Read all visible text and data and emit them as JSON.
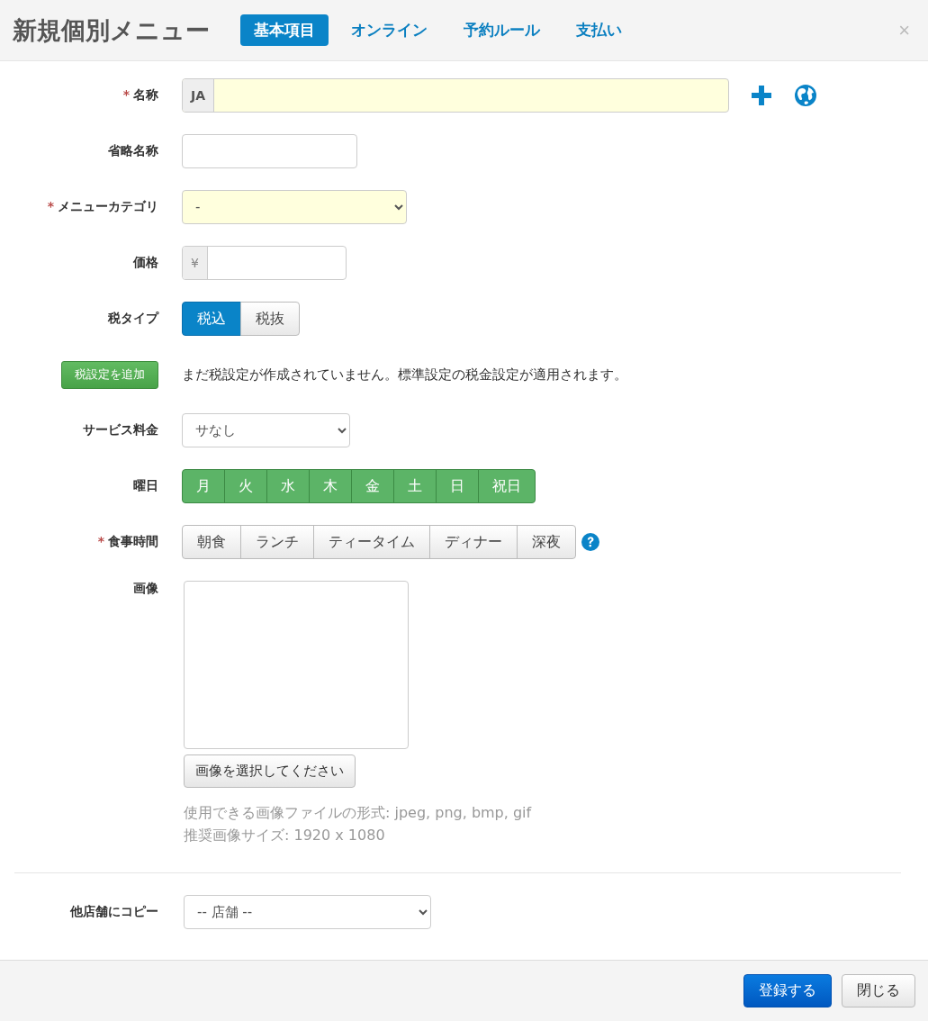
{
  "dialog": {
    "title": "新規個別メニュー",
    "close": "×"
  },
  "tabs": [
    {
      "label": "基本項目",
      "selected": true
    },
    {
      "label": "オンライン",
      "selected": false
    },
    {
      "label": "予約ルール",
      "selected": false
    },
    {
      "label": "支払い",
      "selected": false
    }
  ],
  "fields": [
    {
      "kind": "lang_text",
      "mark": "*",
      "label": "名称",
      "highlighted": true,
      "addon": "JA"
    },
    {
      "kind": "text",
      "label": "省略名称",
      "highlighted": false
    },
    {
      "kind": "select",
      "mark": "*",
      "label": "メニューカテゴリ",
      "highlighted": true,
      "value": "-"
    },
    {
      "kind": "price",
      "label": "価格",
      "highlighted": false,
      "addon": "¥"
    },
    {
      "kind": "toggle",
      "label": "税タイプ",
      "options": [
        {
          "label": "税込",
          "selected": true
        },
        {
          "label": "税抜",
          "selected": false
        }
      ]
    },
    {
      "kind": "action",
      "button": "税設定を追加",
      "note": "まだ税設定が作成されていません。標準設定の税金設定が適用されます。"
    },
    {
      "kind": "service_select",
      "label": "サービス料金",
      "highlighted": false,
      "value": "サなし"
    },
    {
      "kind": "days",
      "label": "曜日",
      "options": [
        {
          "label": "月",
          "selected": true
        },
        {
          "label": "火",
          "selected": true
        },
        {
          "label": "水",
          "selected": true
        },
        {
          "label": "木",
          "selected": true
        },
        {
          "label": "金",
          "selected": true
        },
        {
          "label": "土",
          "selected": true
        },
        {
          "label": "日",
          "selected": true
        },
        {
          "label": "祝日",
          "selected": true
        }
      ]
    },
    {
      "kind": "meals",
      "mark": "*",
      "label": "食事時間",
      "options": [
        {
          "label": "朝食",
          "selected": false
        },
        {
          "label": "ランチ",
          "selected": false
        },
        {
          "label": "ティータイム",
          "selected": false
        },
        {
          "label": "ディナー",
          "selected": false
        },
        {
          "label": "深夜",
          "selected": false
        }
      ]
    },
    {
      "kind": "image",
      "label": "画像",
      "button": "画像を選択してください",
      "help": [
        "使用できる画像ファイルの形式: jpeg, png, bmp, gif",
        "推奨画像サイズ: 1920 x 1080"
      ]
    }
  ],
  "copy": {
    "label": "他店舗にコピー",
    "value": "-- 店舗 --"
  },
  "footer": {
    "buttons": [
      {
        "label": "登録する",
        "kind": "primary"
      },
      {
        "label": "閉じる",
        "kind": "default"
      }
    ]
  }
}
